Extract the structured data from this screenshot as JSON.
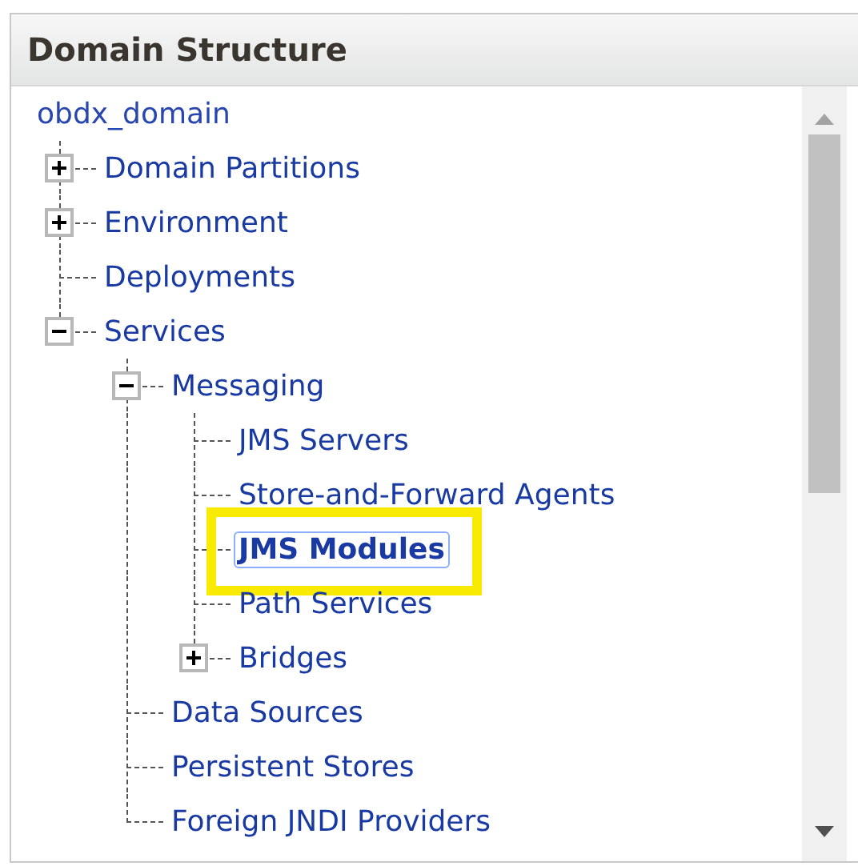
{
  "panel": {
    "title": "Domain Structure"
  },
  "tree": {
    "label": "obdx_domain",
    "children": [
      {
        "label": "Domain Partitions",
        "expanded": false,
        "selected": false,
        "highlighted": false
      },
      {
        "label": "Environment",
        "expanded": false,
        "selected": false,
        "highlighted": false
      },
      {
        "label": "Deployments",
        "selected": false,
        "highlighted": false
      },
      {
        "label": "Services",
        "expanded": true,
        "selected": false,
        "highlighted": false,
        "children": [
          {
            "label": "Messaging",
            "expanded": true,
            "selected": false,
            "highlighted": false,
            "children": [
              {
                "label": "JMS Servers",
                "selected": false,
                "highlighted": false
              },
              {
                "label": "Store-and-Forward Agents",
                "selected": false,
                "highlighted": false
              },
              {
                "label": "JMS Modules",
                "selected": true,
                "highlighted": true
              },
              {
                "label": "Path Services",
                "selected": false,
                "highlighted": false
              },
              {
                "label": "Bridges",
                "expanded": false,
                "selected": false,
                "highlighted": false
              }
            ]
          },
          {
            "label": "Data Sources",
            "selected": false,
            "highlighted": false
          },
          {
            "label": "Persistent Stores",
            "selected": false,
            "highlighted": false
          },
          {
            "label": "Foreign JNDI Providers",
            "selected": false,
            "highlighted": false
          }
        ]
      }
    ]
  }
}
